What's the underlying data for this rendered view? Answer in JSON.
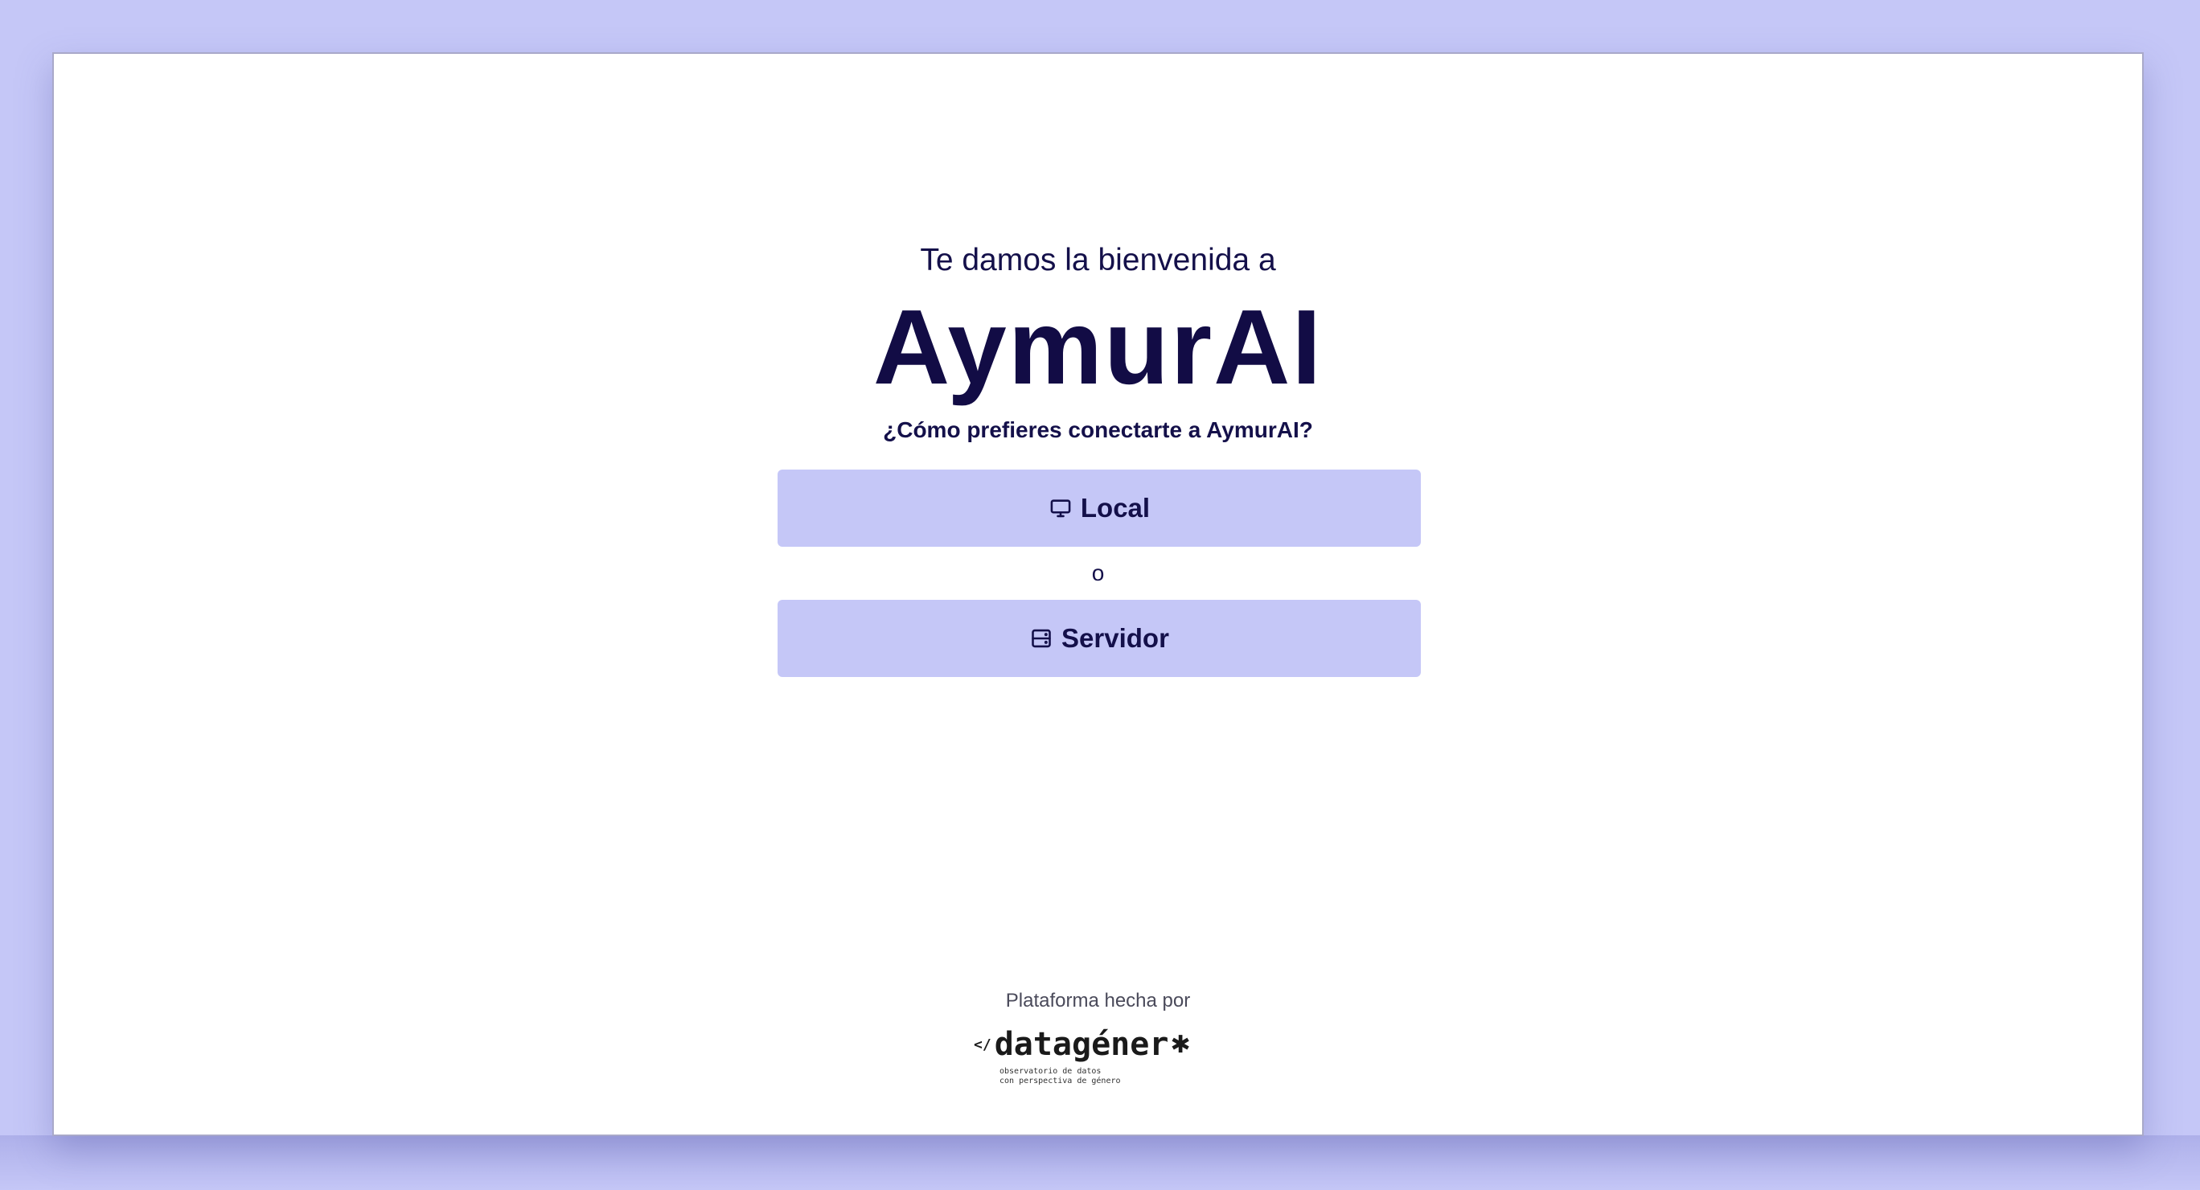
{
  "welcome": {
    "greeting": "Te damos la bienvenida a",
    "app_name": "AymurAI",
    "question": "¿Cómo prefieres conectarte a AymurAI?"
  },
  "connection_options": {
    "local": {
      "label": "Local",
      "icon": "monitor-icon"
    },
    "separator": "o",
    "server": {
      "label": "Servidor",
      "icon": "server-icon"
    }
  },
  "footer": {
    "made_by_label": "Plataforma hecha por",
    "logo": {
      "prefix": "</",
      "name": "datagéner",
      "symbol": "✱",
      "tagline_line1": "observatorio de datos",
      "tagline_line2": "con perspectiva de género"
    }
  },
  "colors": {
    "background": "#c5c7f7",
    "button_bg": "#c5c7f7",
    "text_primary": "#14104a",
    "panel": "#ffffff"
  }
}
